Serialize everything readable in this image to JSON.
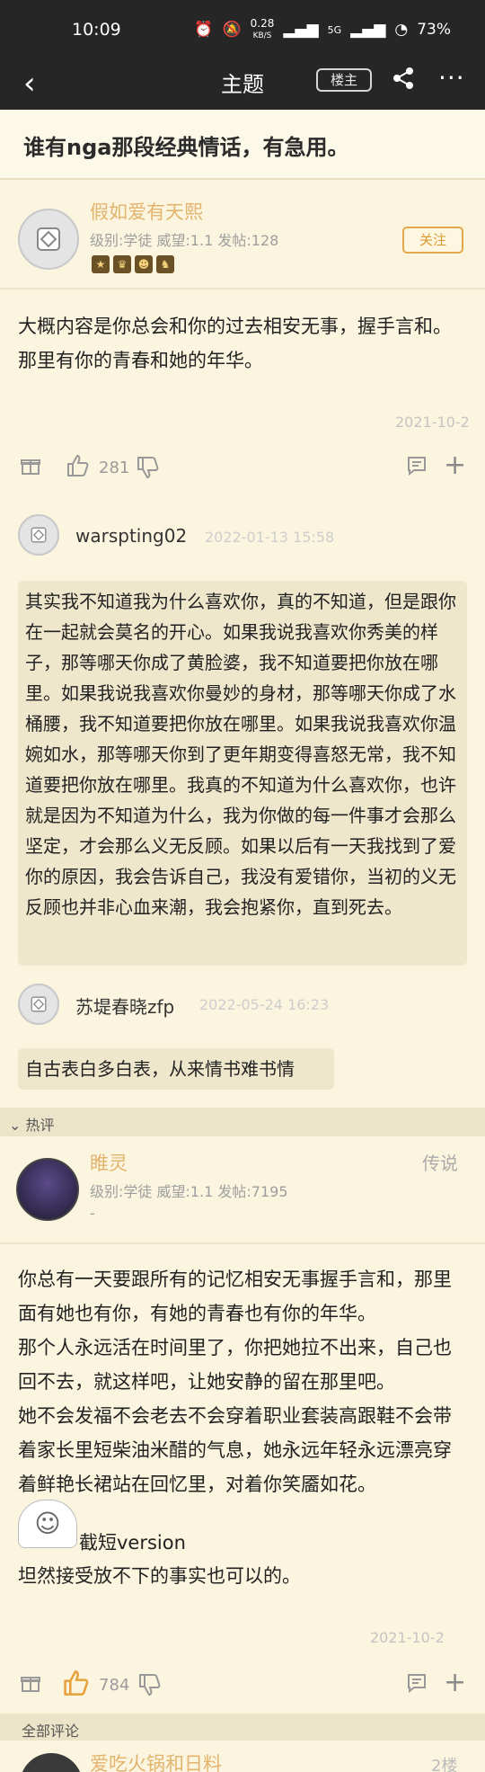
{
  "status_bar": {
    "time": "10:09",
    "speed": "0.28",
    "speed_unit": "KB/S",
    "network": "5G",
    "battery": "73%"
  },
  "nav": {
    "title": "主题",
    "owner_button": "楼主"
  },
  "topic": {
    "title": "谁有nga那段经典情话，有急用。"
  },
  "op": {
    "username": "假如爱有天熙",
    "meta": "级别:学徒 威望:1.1 发帖:128",
    "follow": "关注",
    "content": "大概内容是你总会和你的过去相安无事，握手言和。那里有你的青春和她的年华。",
    "date": "2021-10-2",
    "likes": "281"
  },
  "replies": [
    {
      "username": "warspting02",
      "time": "2022-01-13 15:58",
      "content": "其实我不知道我为什么喜欢你，真的不知道，但是跟你在一起就会莫名的开心。如果我说我喜欢你秀美的样子，那等哪天你成了黄脸婆，我不知道要把你放在哪里。如果我说我喜欢你曼妙的身材，那等哪天你成了水桶腰，我不知道要把你放在哪里。如果我说我喜欢你温婉如水，那等哪天你到了更年期变得喜怒无常，我不知道要把你放在哪里。我真的不知道为什么喜欢你，也许就是因为不知道为什么，我为你做的每一件事才会那么坚定，才会那么义无反顾。如果以后有一天我找到了爱你的原因，我会告诉自己，我没有爱错你，当初的义无反顾也并非心血来潮，我会抱紧你，直到死去。"
    },
    {
      "username": "苏堤春晓zfp",
      "time": "2022-05-24 16:23",
      "content": "自古表白多白表，从来情书难书情"
    }
  ],
  "hot_section": {
    "label": "热评"
  },
  "hot_comment": {
    "username": "睢灵",
    "tag": "传说",
    "meta": "级别:学徒 威望:1.1 发帖:7195",
    "sub": "-",
    "paragraphs": [
      "你总有一天要跟所有的记忆相安无事握手言和，那里面有她也有你，有她的青春也有你的年华。",
      "那个人永远活在时间里了，你把她拉不出来，自己也回不去，就这样吧，让她安静的留在那里吧。",
      "她不会发福不会老去不会穿着职业套装高跟鞋不会带着家长里短柴油米醋的气息，她永远年轻永远漂亮穿着鲜艳长裙站在回忆里，对着你笑靥如花。"
    ],
    "sticker_caption": "截短version",
    "last_line": "坦然接受放不下的事实也可以的。",
    "date": "2021-10-2",
    "likes": "784"
  },
  "all_comments": {
    "label": "全部评论",
    "first_username": "爱吃火锅和日料",
    "first_floor": "2楼"
  }
}
